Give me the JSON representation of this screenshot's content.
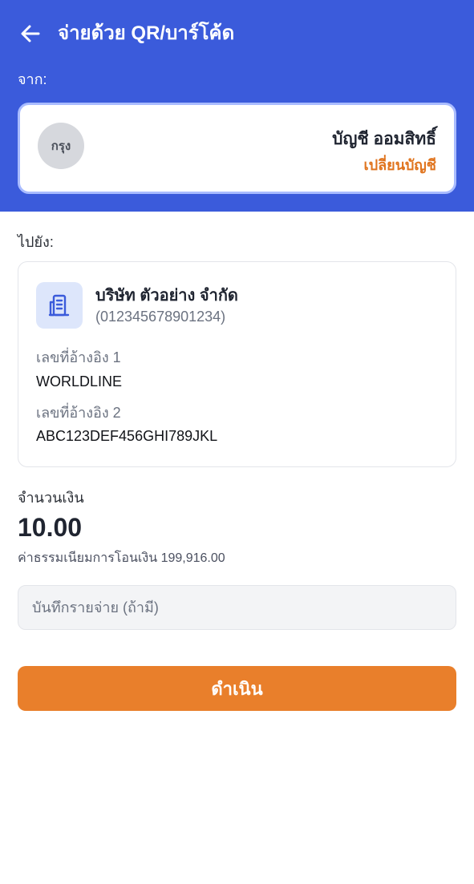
{
  "header": {
    "title": "จ่ายด้วย QR/บาร์โค้ด",
    "from_label": "จาก:",
    "background_color": "#3b5bdb"
  },
  "source_account": {
    "bank_abbr": "กรุง",
    "account_name": "บัญชี ออมสิทธิ์",
    "change_label": "เปลี่ยนบัญชี"
  },
  "destination": {
    "to_label": "ไปยัง:",
    "payee_name": "บริษัท ตัวอย่าง จำกัด",
    "payee_id": "(012345678901234)",
    "references": [
      {
        "label": "เลขที่อ้างอิง 1",
        "value": "WORLDLINE"
      },
      {
        "label": "เลขที่อ้างอิง 2",
        "value": "ABC123DEF456GHI789JKL"
      }
    ]
  },
  "amount": {
    "label": "จำนวนเงิน",
    "value": "10.00",
    "fee_text": "ค่าธรรมเนียมการโอนเงิน 199,916.00"
  },
  "memo": {
    "placeholder": "บันทึกรายจ่าย (ถ้ามี)",
    "value": ""
  },
  "actions": {
    "proceed_label": "ดำเนิน",
    "accent_color": "#e97f2b"
  },
  "icons": {
    "back": "arrow-left-icon",
    "payee": "building-icon"
  }
}
